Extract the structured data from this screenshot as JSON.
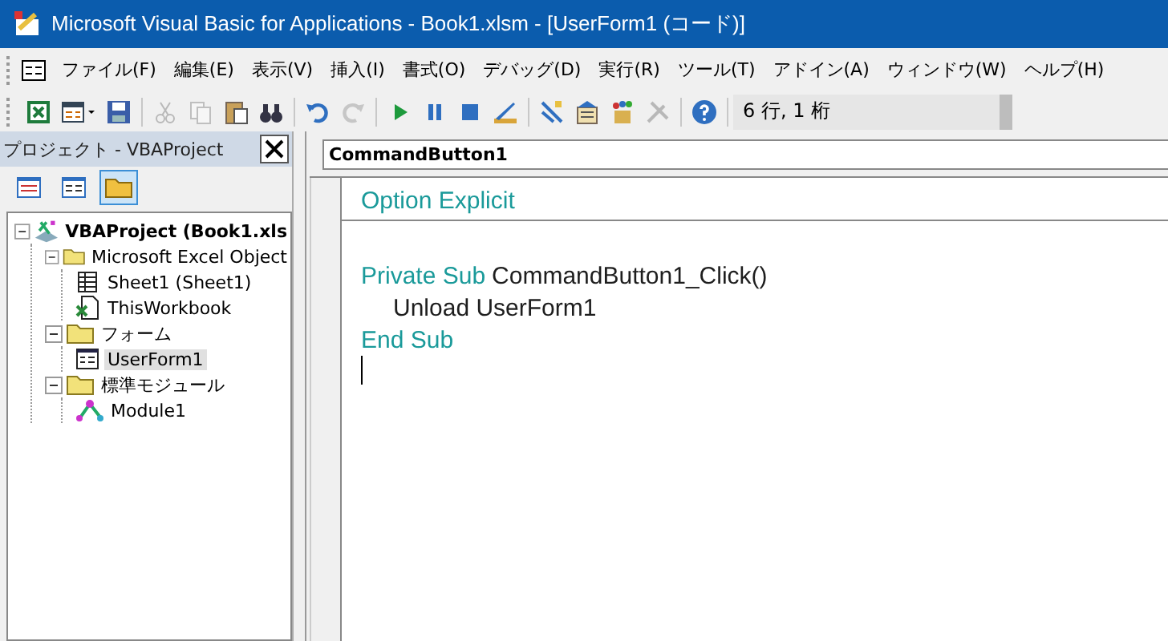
{
  "window": {
    "title": "Microsoft Visual Basic for Applications - Book1.xlsm - [UserForm1 (コード)]"
  },
  "menu": [
    "ファイル(F)",
    "編集(E)",
    "表示(V)",
    "挿入(I)",
    "書式(O)",
    "デバッグ(D)",
    "実行(R)",
    "ツール(T)",
    "アドイン(A)",
    "ウィンドウ(W)",
    "ヘルプ(H)"
  ],
  "toolbar": {
    "buttons": [
      {
        "kind": "excel",
        "disabled": false
      },
      {
        "kind": "insert-form",
        "disabled": false
      },
      {
        "kind": "save",
        "disabled": false
      },
      {
        "kind": "sep"
      },
      {
        "kind": "cut",
        "disabled": true
      },
      {
        "kind": "copy",
        "disabled": true
      },
      {
        "kind": "paste",
        "disabled": false
      },
      {
        "kind": "find",
        "disabled": false
      },
      {
        "kind": "sep"
      },
      {
        "kind": "undo",
        "disabled": false
      },
      {
        "kind": "redo",
        "disabled": true
      },
      {
        "kind": "sep"
      },
      {
        "kind": "run",
        "disabled": false
      },
      {
        "kind": "pause",
        "disabled": false
      },
      {
        "kind": "stop",
        "disabled": false
      },
      {
        "kind": "design",
        "disabled": false
      },
      {
        "kind": "sep"
      },
      {
        "kind": "explorer",
        "disabled": false
      },
      {
        "kind": "properties",
        "disabled": false
      },
      {
        "kind": "objects",
        "disabled": false
      },
      {
        "kind": "tools",
        "disabled": true
      },
      {
        "kind": "sep"
      },
      {
        "kind": "help",
        "disabled": false
      }
    ],
    "position": "6 行, 1 桁"
  },
  "project_panel": {
    "title": "プロジェクト - VBAProject",
    "buttons": [
      {
        "kind": "view-code",
        "selected": false
      },
      {
        "kind": "view-object",
        "selected": false
      },
      {
        "kind": "toggle-folders",
        "selected": true
      }
    ],
    "tree": [
      {
        "label": "VBAProject (Book1.xls",
        "kind": "project",
        "expanded": true,
        "selected": false,
        "children": [
          {
            "label": "Microsoft Excel Object",
            "kind": "folder",
            "expanded": true,
            "selected": false,
            "children": [
              {
                "label": "Sheet1 (Sheet1)",
                "kind": "sheet",
                "selected": false
              },
              {
                "label": "ThisWorkbook",
                "kind": "workbook",
                "selected": false
              }
            ]
          },
          {
            "label": "フォーム",
            "kind": "folder",
            "expanded": true,
            "selected": false,
            "children": [
              {
                "label": "UserForm1",
                "kind": "form",
                "selected": true
              }
            ]
          },
          {
            "label": "標準モジュール",
            "kind": "folder",
            "expanded": true,
            "selected": false,
            "children": [
              {
                "label": "Module1",
                "kind": "module",
                "selected": false
              }
            ]
          }
        ]
      }
    ]
  },
  "code_window": {
    "object": "CommandButton1",
    "sections": [
      {
        "lines": [
          {
            "indent": false,
            "tokens": [
              {
                "text": "Option Explicit",
                "kind": "keyword"
              }
            ]
          }
        ]
      },
      {
        "lines": [
          {
            "indent": false,
            "tokens": [
              {
                "text": "Private Sub",
                "kind": "keyword"
              },
              {
                "text": "CommandButton1_Click()",
                "kind": "plain"
              }
            ]
          },
          {
            "indent": true,
            "tokens": [
              {
                "text": "Unload UserForm1",
                "kind": "plain"
              }
            ]
          },
          {
            "indent": false,
            "tokens": [
              {
                "text": "End Sub",
                "kind": "keyword"
              }
            ]
          }
        ]
      }
    ],
    "cursor": true
  }
}
